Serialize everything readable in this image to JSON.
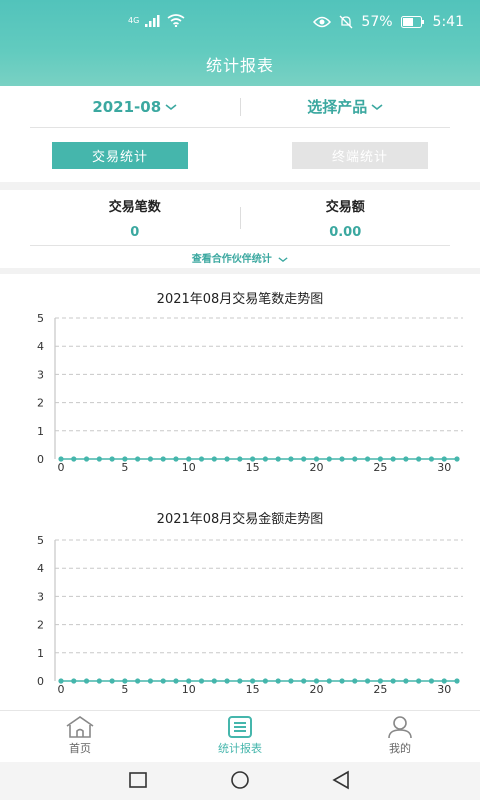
{
  "status": {
    "network": "4G",
    "battery": "57%",
    "time": "5:41"
  },
  "header": {
    "title": "统计报表"
  },
  "filters": {
    "month": "2021-08",
    "product": "选择产品"
  },
  "tabs": [
    {
      "label": "交易统计",
      "active": true
    },
    {
      "label": "终端统计",
      "active": false
    }
  ],
  "summary": {
    "count_label": "交易笔数",
    "count_value": "0",
    "amount_label": "交易额",
    "amount_value": "0.00",
    "partner_link": "查看合作伙伴统计"
  },
  "colors": {
    "accent": "#45b6ac",
    "accent_text": "#3ba8a0",
    "header_top": "#52c3bb"
  },
  "chart_data": [
    {
      "type": "line",
      "title": "2021年08月交易笔数走势图",
      "x": [
        0,
        1,
        2,
        3,
        4,
        5,
        6,
        7,
        8,
        9,
        10,
        11,
        12,
        13,
        14,
        15,
        16,
        17,
        18,
        19,
        20,
        21,
        22,
        23,
        24,
        25,
        26,
        27,
        28,
        29,
        30,
        31
      ],
      "values": [
        0,
        0,
        0,
        0,
        0,
        0,
        0,
        0,
        0,
        0,
        0,
        0,
        0,
        0,
        0,
        0,
        0,
        0,
        0,
        0,
        0,
        0,
        0,
        0,
        0,
        0,
        0,
        0,
        0,
        0,
        0,
        0
      ],
      "xticks": [
        0,
        5,
        10,
        15,
        20,
        25,
        30
      ],
      "yticks": [
        0,
        1,
        2,
        3,
        4,
        5
      ],
      "ylim": [
        0,
        5
      ],
      "grid": true
    },
    {
      "type": "line",
      "title": "2021年08月交易金额走势图",
      "x": [
        0,
        1,
        2,
        3,
        4,
        5,
        6,
        7,
        8,
        9,
        10,
        11,
        12,
        13,
        14,
        15,
        16,
        17,
        18,
        19,
        20,
        21,
        22,
        23,
        24,
        25,
        26,
        27,
        28,
        29,
        30,
        31
      ],
      "values": [
        0,
        0,
        0,
        0,
        0,
        0,
        0,
        0,
        0,
        0,
        0,
        0,
        0,
        0,
        0,
        0,
        0,
        0,
        0,
        0,
        0,
        0,
        0,
        0,
        0,
        0,
        0,
        0,
        0,
        0,
        0,
        0
      ],
      "xticks": [
        0,
        5,
        10,
        15,
        20,
        25,
        30
      ],
      "yticks": [
        0,
        1,
        2,
        3,
        4,
        5
      ],
      "ylim": [
        0,
        5
      ],
      "grid": true
    }
  ],
  "bottom_nav": [
    {
      "label": "首页",
      "icon": "home-icon",
      "active": false
    },
    {
      "label": "统计报表",
      "icon": "report-icon",
      "active": true
    },
    {
      "label": "我的",
      "icon": "user-icon",
      "active": false
    }
  ]
}
